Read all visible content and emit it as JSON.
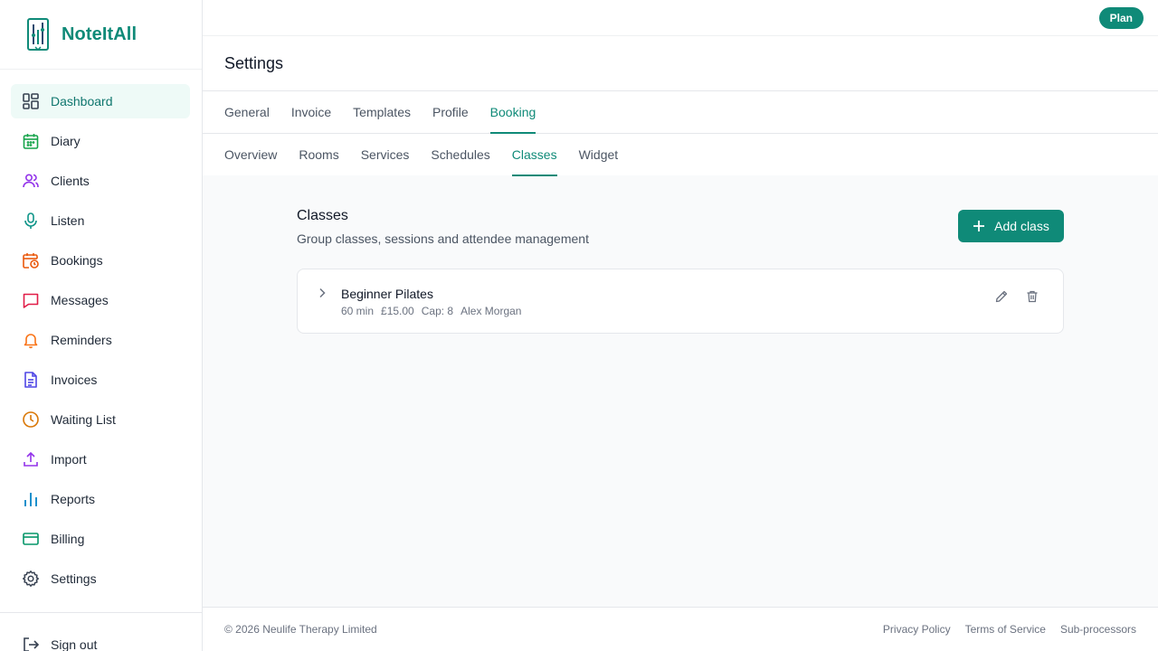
{
  "brand": {
    "name": "NoteItAll"
  },
  "sidebar": {
    "items": [
      {
        "label": "Dashboard",
        "icon": "dashboard-icon"
      },
      {
        "label": "Diary",
        "icon": "calendar-icon"
      },
      {
        "label": "Clients",
        "icon": "users-icon"
      },
      {
        "label": "Listen",
        "icon": "microphone-icon"
      },
      {
        "label": "Bookings",
        "icon": "calendar-clock-icon"
      },
      {
        "label": "Messages",
        "icon": "message-icon"
      },
      {
        "label": "Reminders",
        "icon": "bell-icon"
      },
      {
        "label": "Invoices",
        "icon": "document-icon"
      },
      {
        "label": "Waiting List",
        "icon": "clock-icon"
      },
      {
        "label": "Import",
        "icon": "upload-icon"
      },
      {
        "label": "Reports",
        "icon": "bar-chart-icon"
      },
      {
        "label": "Billing",
        "icon": "credit-card-icon"
      },
      {
        "label": "Settings",
        "icon": "gear-icon"
      }
    ],
    "active": "Dashboard",
    "signout_label": "Sign out"
  },
  "topbar": {
    "plan_label": "Plan"
  },
  "page": {
    "title": "Settings"
  },
  "tabs": {
    "primary": [
      "General",
      "Invoice",
      "Templates",
      "Profile",
      "Booking"
    ],
    "primary_active": "Booking",
    "secondary": [
      "Overview",
      "Rooms",
      "Services",
      "Schedules",
      "Classes",
      "Widget"
    ],
    "secondary_active": "Classes"
  },
  "classes_section": {
    "title": "Classes",
    "subtitle": "Group classes, sessions and attendee management",
    "add_label": "Add class",
    "items": [
      {
        "name": "Beginner Pilates",
        "duration": "60 min",
        "price": "£15.00",
        "capacity": "Cap: 8",
        "instructor": "Alex Morgan"
      }
    ]
  },
  "footer": {
    "copyright": "© 2026 Neulife Therapy Limited",
    "links": [
      "Privacy Policy",
      "Terms of Service",
      "Sub-processors"
    ]
  },
  "colors": {
    "accent": "#0f8a78",
    "active_bg": "#eefaf7"
  }
}
